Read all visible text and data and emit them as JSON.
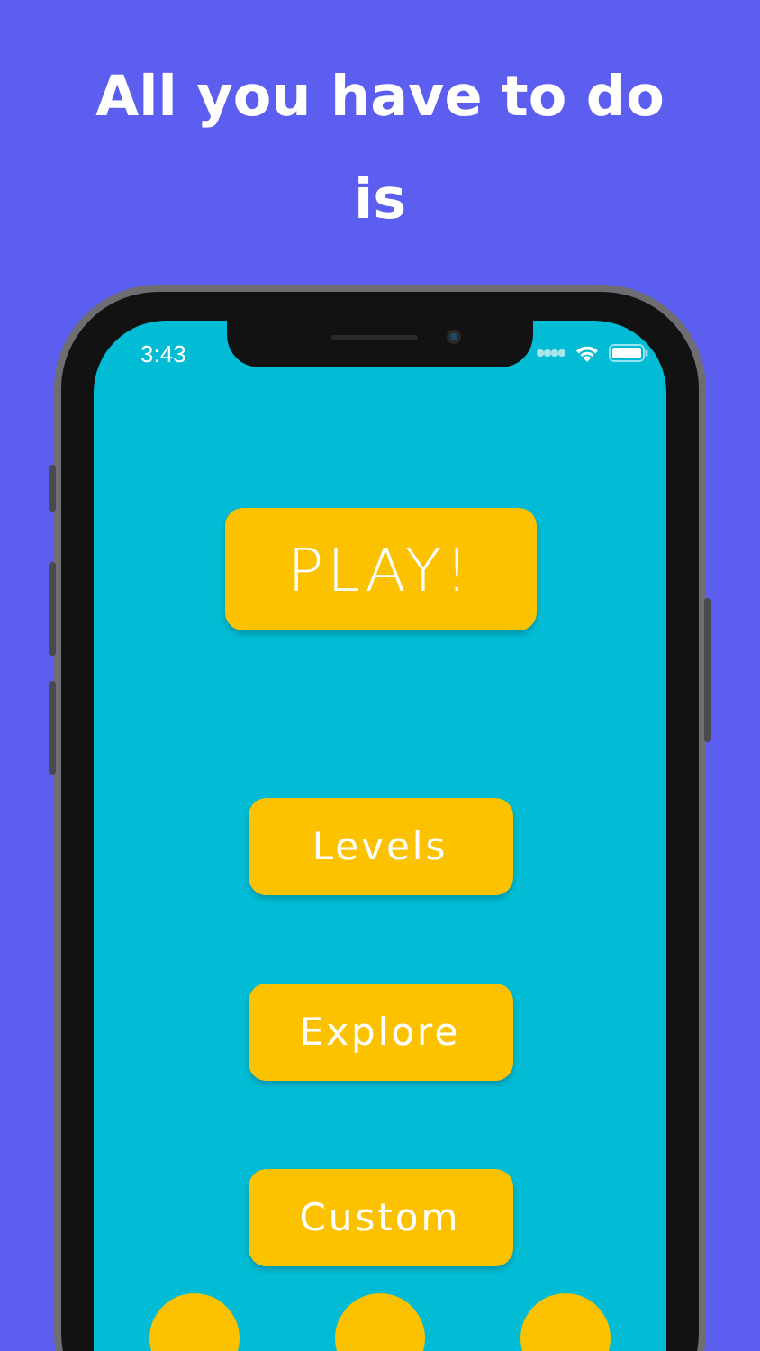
{
  "headline": "All you have to do is",
  "status_bar": {
    "time": "3:43"
  },
  "play_button": {
    "label": "PLAY!"
  },
  "menu_buttons": [
    {
      "label": "Levels"
    },
    {
      "label": "Explore"
    },
    {
      "label": "Custom"
    }
  ]
}
